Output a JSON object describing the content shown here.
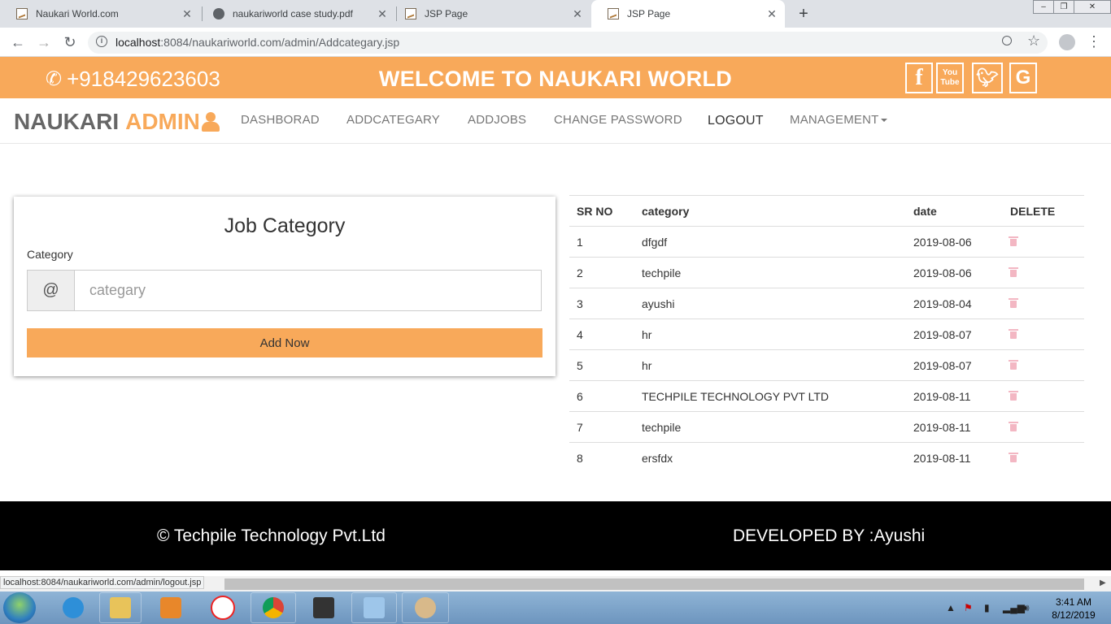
{
  "browser": {
    "tabs": [
      {
        "title": "Naukari World.com",
        "active": false
      },
      {
        "title": "naukariworld case study.pdf",
        "active": false
      },
      {
        "title": "JSP Page",
        "active": false
      },
      {
        "title": "JSP Page",
        "active": true
      }
    ],
    "url_host": "localhost",
    "url_rest": ":8084/naukariworld.com/admin/Addcategary.jsp",
    "status_url": "localhost:8084/naukariworld.com/admin/logout.jsp"
  },
  "topbar": {
    "phone": "+918429623603",
    "welcome": "WELCOME TO NAUKARI WORLD",
    "social": [
      "facebook-icon",
      "youtube-icon",
      "twitter-icon",
      "google-icon"
    ],
    "youtube_top": "You",
    "youtube_bottom": "Tube"
  },
  "navbar": {
    "brand_main": "NAUKARI",
    "brand_accent": "ADMIN",
    "links": [
      "DASHBORAD",
      "ADDCATEGARY",
      "ADDJOBS",
      "CHANGE PASSWORD",
      "LOGOUT",
      "MANAGEMENT"
    ]
  },
  "form": {
    "title": "Job Category",
    "label": "Category",
    "addon": "@",
    "placeholder": "categary",
    "button": "Add Now"
  },
  "table": {
    "headers": [
      "SR NO",
      "category",
      "date",
      "DELETE"
    ],
    "rows": [
      {
        "sr": "1",
        "category": "dfgdf",
        "date": "2019-08-06"
      },
      {
        "sr": "2",
        "category": "techpile",
        "date": "2019-08-06"
      },
      {
        "sr": "3",
        "category": "ayushi",
        "date": "2019-08-04"
      },
      {
        "sr": "4",
        "category": "hr",
        "date": "2019-08-07"
      },
      {
        "sr": "5",
        "category": "hr",
        "date": "2019-08-07"
      },
      {
        "sr": "6",
        "category": "TECHPILE TECHNOLOGY PVT LTD",
        "date": "2019-08-11"
      },
      {
        "sr": "7",
        "category": "techpile",
        "date": "2019-08-11"
      },
      {
        "sr": "8",
        "category": "ersfdx",
        "date": "2019-08-11"
      }
    ]
  },
  "footer": {
    "copyright": "© Techpile Technology Pvt.Ltd",
    "developer": "DEVELOPED BY :Ayushi"
  },
  "taskbar": {
    "time": "3:41 AM",
    "date": "8/12/2019"
  },
  "colors": {
    "accent": "#f8a95a",
    "footer_bg": "#000000",
    "trash": "#f3b7c3"
  }
}
